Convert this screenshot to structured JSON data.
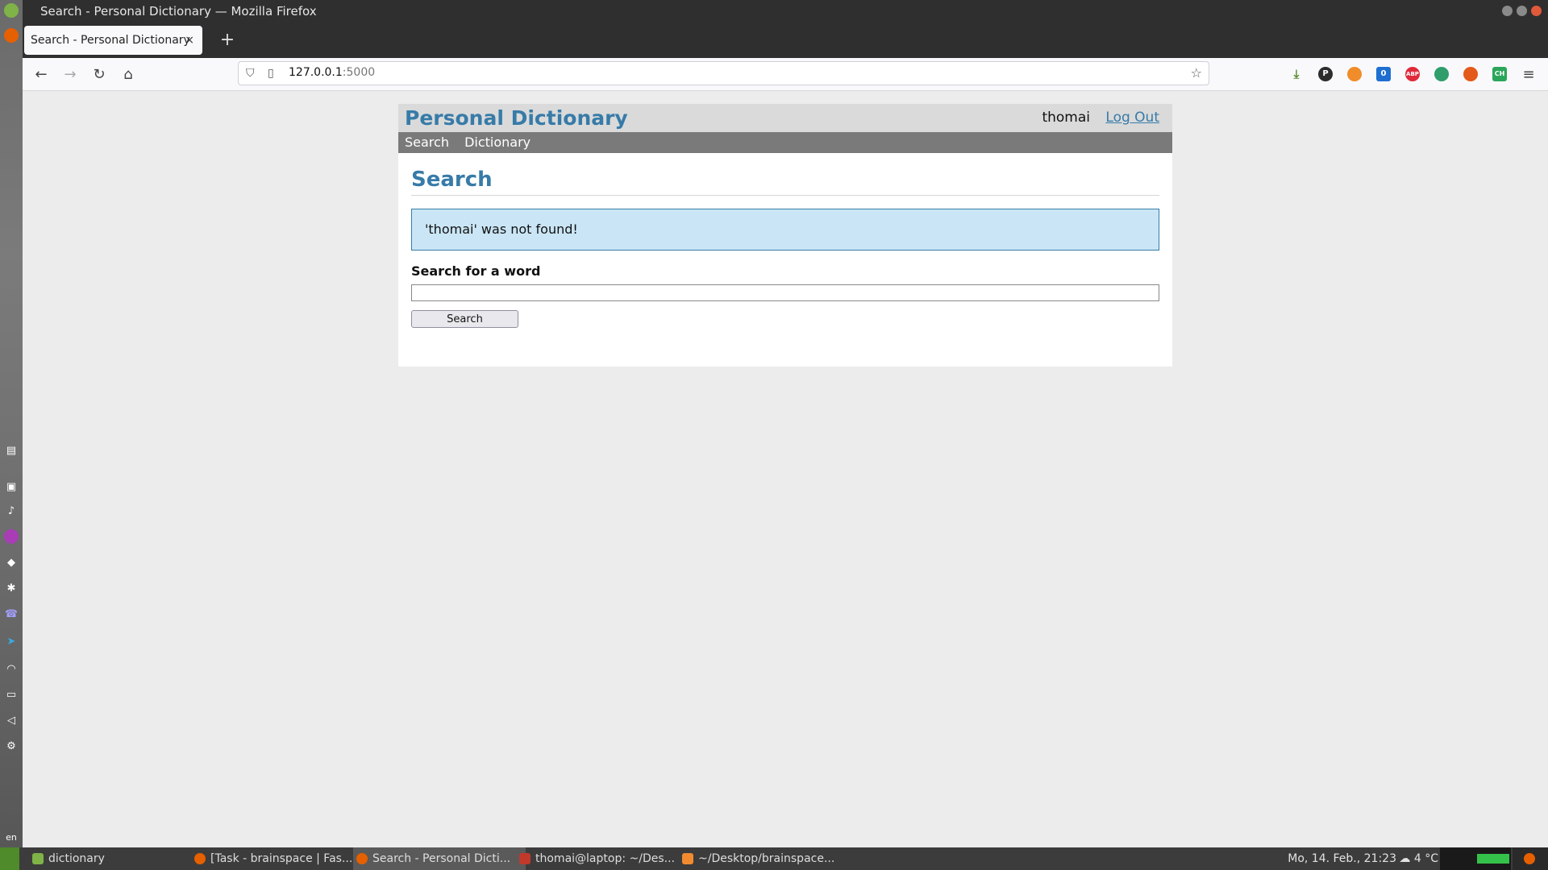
{
  "window": {
    "title": "Search - Personal Dictionary — Mozilla Firefox"
  },
  "tab": {
    "title": "Search - Personal Dictionary",
    "close": "×",
    "new_tab": "+"
  },
  "toolbar": {
    "url_host": "127.0.0.1",
    "url_port": ":5000"
  },
  "extensions": [
    {
      "name": "download-icon",
      "color": "#5b8a2f"
    },
    {
      "name": "p-extension-icon",
      "label": "P",
      "color": "#2c2c2c"
    },
    {
      "name": "orange-extension-icon",
      "color": "#f08c2a"
    },
    {
      "name": "notification-extension-icon",
      "label": "0",
      "color": "#1f6fd1"
    },
    {
      "name": "adblock-icon",
      "label": "ABP",
      "color": "#e0293b"
    },
    {
      "name": "green-extension-icon",
      "color": "#2f9e6a"
    },
    {
      "name": "duckduckgo-icon",
      "color": "#e35a1a"
    },
    {
      "name": "ch-extension-icon",
      "label": "CH",
      "color": "#2aa65a"
    }
  ],
  "app": {
    "title": "Personal Dictionary",
    "username": "thomai",
    "logout_label": "Log Out",
    "nav": [
      "Search",
      "Dictionary"
    ],
    "page_heading": "Search",
    "flash_message": "'thomai' was not found!",
    "search_label": "Search for a word",
    "search_value": "",
    "search_button": "Search"
  },
  "taskbar": {
    "tasks": [
      {
        "label": "dictionary",
        "icon": "folder-icon",
        "color": "#7fb347"
      },
      {
        "label": "[Task - brainspace | Fas...",
        "icon": "firefox-icon",
        "color": "#e66000"
      },
      {
        "label": "Search - Personal Dicti...",
        "icon": "firefox-icon",
        "color": "#e66000"
      },
      {
        "label": "thomai@laptop: ~/Des...",
        "icon": "terminal-icon",
        "color": "#c0392b"
      },
      {
        "label": "~/Desktop/brainspace...",
        "icon": "sublime-icon",
        "color": "#f28b30"
      }
    ],
    "clock": "Mo, 14. Feb., 21:23",
    "weather": "4 °C",
    "keyboard": "en"
  }
}
